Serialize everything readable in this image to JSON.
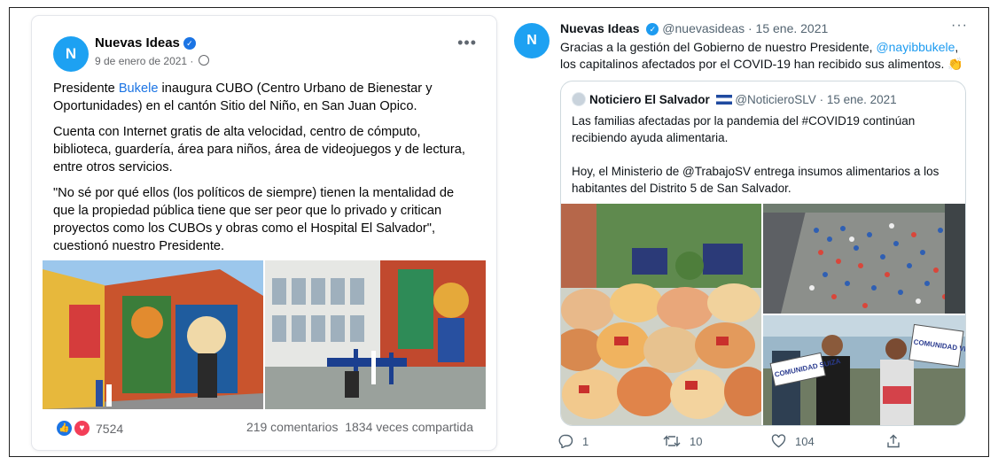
{
  "facebook_post": {
    "avatar_letter": "N",
    "author": "Nuevas Ideas",
    "date": "9 de enero de 2021 ·",
    "more": "•••",
    "paragraph1_prefix": "Presidente ",
    "paragraph1_link": "Bukele",
    "paragraph1_suffix": " inaugura CUBO (Centro Urbano de Bienestar y Oportunidades) en el cantón Sitio del Niño, en San Juan Opico.",
    "paragraph2": "Cuenta con Internet gratis de alta velocidad, centro de cómputo, biblioteca, guardería, área para niños, área de videojuegos y de lectura, entre otros servicios.",
    "paragraph3": "\"No sé por qué ellos (los políticos de siempre) tienen la mentalidad de que la propiedad pública tiene que ser peor que lo privado y critican proyectos como los CUBOs y obras como el Hospital El Salvador\", cuestionó nuestro Presidente.",
    "reactions_count": "7524",
    "comments": "219 comentarios",
    "shares": "1834 veces compartida"
  },
  "tweet": {
    "avatar_letter": "N",
    "author": "Nuevas Ideas",
    "handle_date": "@nuevasideas · 15 ene. 2021",
    "more": "···",
    "text_before": "Gracias a la gestión del Gobierno de nuestro Presidente, ",
    "mention": "@nayibbukele",
    "text_after": ", los capitalinos afectados por el COVID-19 han recibido sus alimentos. 👏",
    "quoted": {
      "author": "Noticiero El Salvador",
      "handle_date": "@NoticieroSLV · 15 ene. 2021",
      "paragraph1": "Las familias afectadas por la pandemia del #COVID19 continúan recibiendo ayuda alimentaria.",
      "paragraph2": "Hoy, el Ministerio de @TrabajoSV entrega insumos alimentarios a los habitantes del Distrito 5 de San Salvador.",
      "sign1": "COMUNIDAD SUIZA",
      "sign2": "COMUNIDAD VISTA ALEGRE"
    },
    "replies": "1",
    "retweets": "10",
    "likes": "104"
  },
  "colors": {
    "facebook_blue": "#1b74e4",
    "twitter_blue": "#1d9bf0",
    "avatar": "#1da1f2",
    "love_red": "#f33e58"
  }
}
